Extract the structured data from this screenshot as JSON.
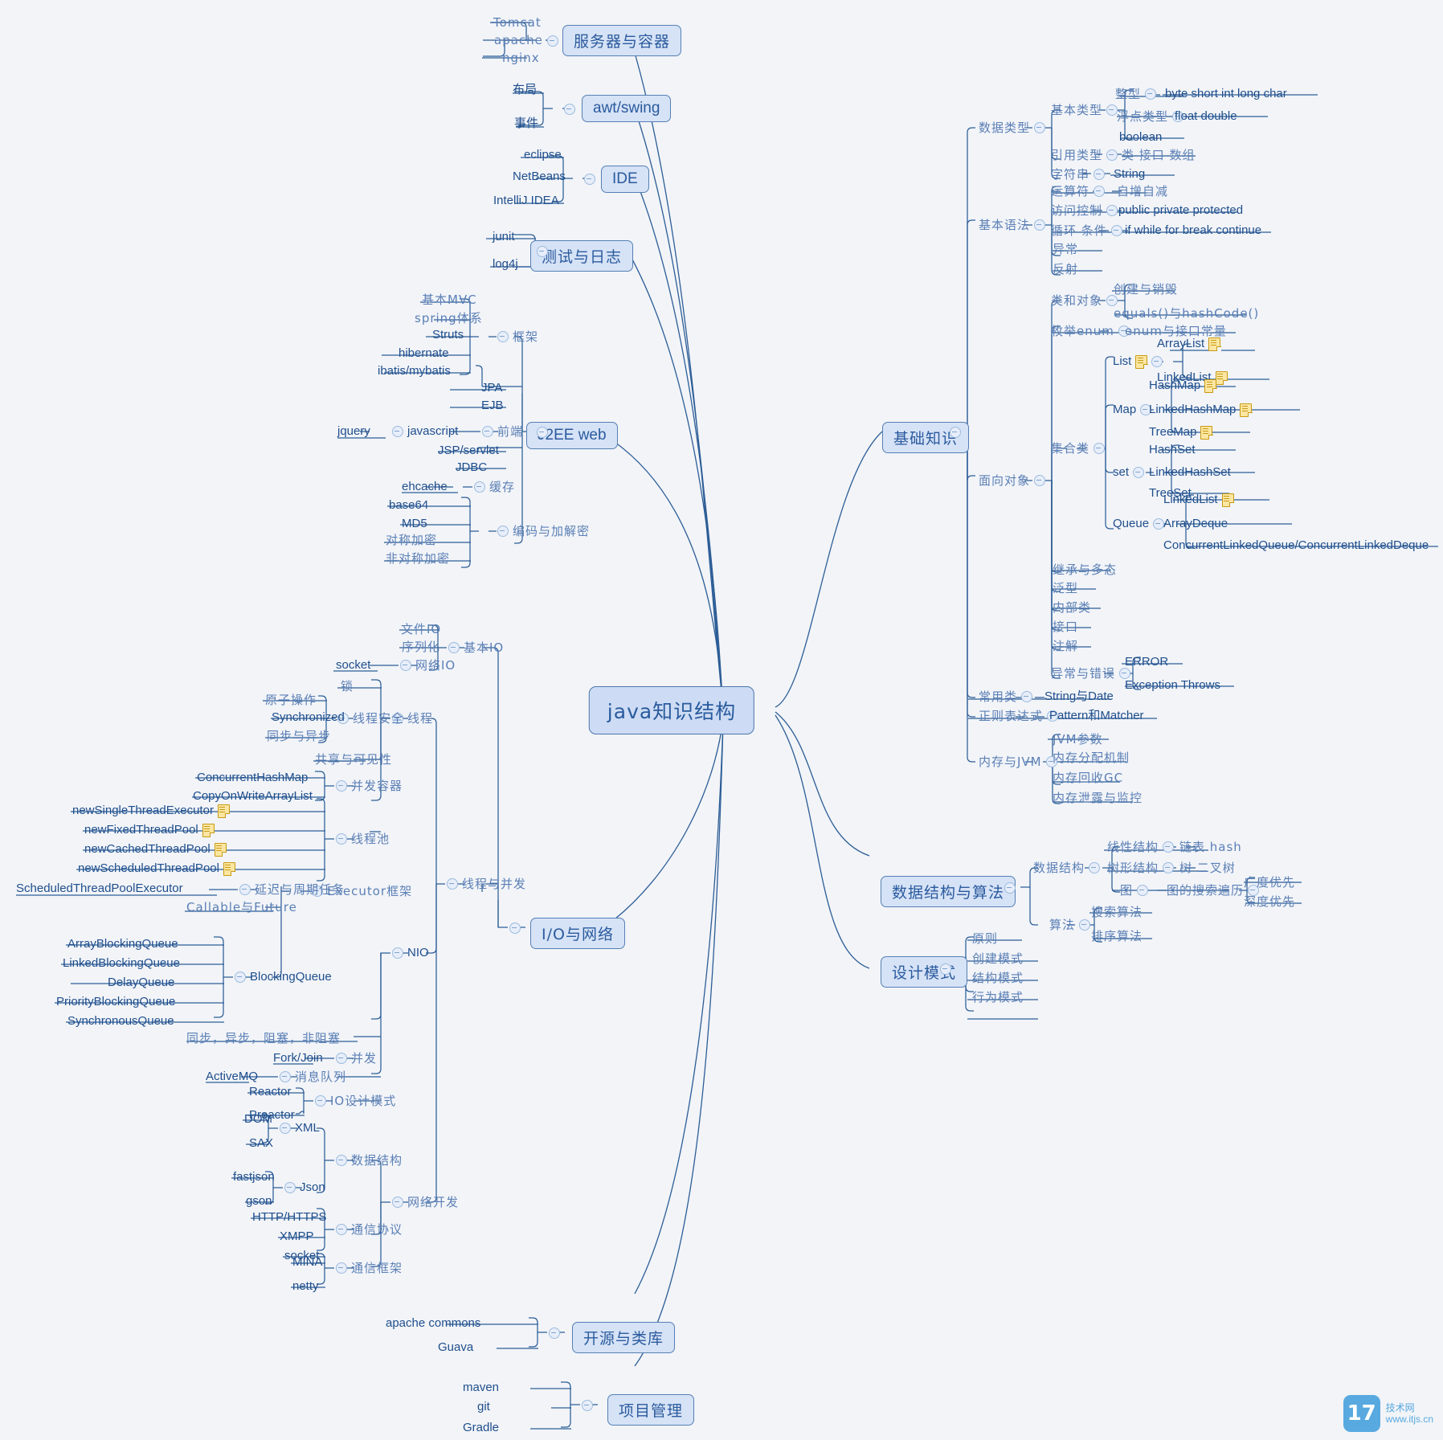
{
  "root": {
    "label": "java知识结构"
  },
  "icons": {
    "toggle": "collapse-toggle-icon",
    "note": "note-icon"
  },
  "watermark": {
    "mark": "17",
    "line1": "技术网",
    "line2": "www.itjs.cn"
  },
  "left": {
    "servers": {
      "label": "服务器与容器",
      "children": [
        "Tomcat",
        "apache",
        "nginx"
      ]
    },
    "awt": {
      "label": "awt/swing",
      "children": [
        "布局",
        "事件"
      ]
    },
    "ide": {
      "label": "IDE",
      "children": [
        "eclipse",
        "NetBeans",
        "IntelliJ IDEA"
      ]
    },
    "test": {
      "label": "测试与日志",
      "children": [
        "junit",
        "log4j"
      ]
    },
    "j2ee": {
      "label": "J2EE web",
      "framework": {
        "label": "框架",
        "children": [
          "基本MVC",
          "spring体系",
          "Struts",
          "hibernate",
          "ibatis/mybatis"
        ]
      },
      "jpa": "JPA",
      "ejb": "EJB",
      "front": {
        "label": "前端",
        "child": "javascript",
        "grandchild": "jquery"
      },
      "jsp": "JSP/servlet",
      "jdbc": "JDBC",
      "cache": {
        "label": "缓存",
        "child": "ehcache"
      },
      "crypt": {
        "label": "编码与加解密",
        "children": [
          "base64",
          "MD5",
          "对称加密",
          "非对称加密"
        ]
      }
    },
    "io": {
      "label": "I/O与网络",
      "basic_io": {
        "label": "基本IO",
        "children": [
          "文件IO",
          "序列化"
        ],
        "net_io": {
          "label": "网络IO",
          "child": "socket"
        }
      },
      "thread_concurrency": {
        "label": "线程与并发",
        "thread": {
          "label": "线程",
          "lock": "锁",
          "safety": {
            "label": "线程安全",
            "children": [
              "原子操作",
              "Synchronized",
              "同步与异步"
            ]
          },
          "share": "共享与可见性",
          "containers": {
            "label": "并发容器",
            "children": [
              "ConcurrentHashMap",
              "CopyOnWriteArrayList"
            ]
          },
          "pool": {
            "label": "线程池",
            "children": [
              "newSingleThreadExecutor",
              "newFixedThreadPool",
              "newCachedThreadPool",
              "newScheduledThreadPool"
            ]
          },
          "executor": {
            "label": "Executor框架",
            "delay": {
              "label": "延迟与周期任务",
              "child": "ScheduledThreadPoolExecutor"
            },
            "callable": "Callable与Future",
            "blocking": {
              "label": "BlockingQueue",
              "children": [
                "ArrayBlockingQueue",
                "LinkedBlockingQueue",
                "DelayQueue",
                "PriorityBlockingQueue",
                "SynchronousQueue"
              ]
            }
          }
        },
        "nio": {
          "label": "NIO",
          "modes": "同步，异步，阻塞，非阻塞",
          "concurrent": {
            "label": "并发",
            "child": "Fork/Join"
          },
          "mq": {
            "label": "消息队列",
            "child": "ActiveMQ"
          },
          "io_pattern": {
            "label": "IO设计模式",
            "children": [
              "Reactor",
              "Proactor"
            ]
          }
        },
        "network_dev": {
          "label": "网络开发",
          "data_struct": {
            "label": "数据结构",
            "xml": {
              "label": "XML",
              "children": [
                "DOM",
                "SAX"
              ]
            },
            "json": {
              "label": "Json",
              "children": [
                "fastjson",
                "gson"
              ]
            }
          },
          "protocol": {
            "label": "通信协议",
            "children": [
              "HTTP/HTTPS",
              "XMPP",
              "socket"
            ]
          },
          "framework": {
            "label": "通信框架",
            "children": [
              "MINA",
              "netty"
            ]
          }
        }
      }
    },
    "opensource": {
      "label": "开源与类库",
      "children": [
        "apache commons",
        "Guava"
      ]
    },
    "project": {
      "label": "项目管理",
      "children": [
        "maven",
        "git",
        "Gradle"
      ]
    }
  },
  "right": {
    "basics": {
      "label": "基础知识",
      "datatype": {
        "label": "数据类型",
        "primitive": {
          "label": "基本类型",
          "integer": {
            "label": "整型",
            "child": "byte short int long char"
          },
          "float": {
            "label": "浮点类型",
            "child": "float  double"
          },
          "boolean": "boolean"
        },
        "reference": {
          "label": "引用类型",
          "child": "类 接口 数组"
        },
        "string": {
          "label": "字符串",
          "child": "String"
        }
      },
      "syntax": {
        "label": "基本语法",
        "operator": {
          "label": "运算符",
          "child": "自增自减"
        },
        "access": {
          "label": "访问控制",
          "child": "public private protected"
        },
        "loop": {
          "label": "循环 条件",
          "child": "if while for break continue"
        },
        "exception": "异常",
        "reflect": "反射"
      },
      "oop": {
        "label": "面向对象",
        "classobj": {
          "label": "类和对象",
          "children": [
            "创建与销毁",
            "equals()与hashCode()"
          ]
        },
        "enum": {
          "label": "枚举enum",
          "child": "enum与接口常量"
        },
        "collections": {
          "label": "集合类",
          "list": {
            "label": "List",
            "note": true,
            "children": [
              {
                "label": "ArrayList",
                "note": true
              },
              {
                "label": "LinkedList",
                "note": true
              }
            ]
          },
          "map": {
            "label": "Map",
            "children": [
              {
                "label": "HashMap",
                "note": true
              },
              {
                "label": "LinkedHashMap",
                "note": true
              },
              {
                "label": "TreeMap",
                "note": true
              }
            ]
          },
          "set": {
            "label": "set",
            "children": [
              {
                "label": "HashSet",
                "note": false
              },
              {
                "label": "LinkedHashSet",
                "note": false
              },
              {
                "label": "TreeSet",
                "note": false
              }
            ]
          },
          "queue": {
            "label": "Queue",
            "children": [
              {
                "label": "LinkedList",
                "note": true
              },
              {
                "label": "ArrayDeque",
                "note": false
              },
              {
                "label": "ConcurrentLinkedQueue/ConcurrentLinkedDeque",
                "note": false
              }
            ]
          }
        },
        "inherit": "继承与多态",
        "generic": "泛型",
        "inner": "内部类",
        "interface": "接口",
        "annotation": "注解",
        "errors": {
          "label": "异常与错误",
          "children": [
            "ERROR",
            "Exception Throws"
          ]
        }
      },
      "common": {
        "label": "常用类",
        "child": "String与Date"
      },
      "regex": {
        "label": "正则表达式",
        "child": "Pattern和Matcher"
      },
      "jvm": {
        "label": "内存与JVM",
        "children": [
          "JVM参数",
          "内存分配机制",
          "内存回收GC",
          "内存泄露与监控"
        ]
      }
    },
    "ds": {
      "label": "数据结构与算法",
      "structures": {
        "label": "数据结构",
        "linear": {
          "label": "线性结构",
          "child": "链表 hash"
        },
        "tree": {
          "label": "树形结构",
          "child": "树  二叉树"
        },
        "graph": {
          "label": "图",
          "child": "图的搜索遍历",
          "leaves": [
            "广度优先",
            "深度优先"
          ]
        }
      },
      "algos": {
        "label": "算法",
        "children": [
          "搜索算法",
          "排序算法"
        ]
      }
    },
    "patterns": {
      "label": "设计模式",
      "children": [
        "原则",
        "创建模式",
        "结构模式",
        "行为模式"
      ]
    }
  }
}
